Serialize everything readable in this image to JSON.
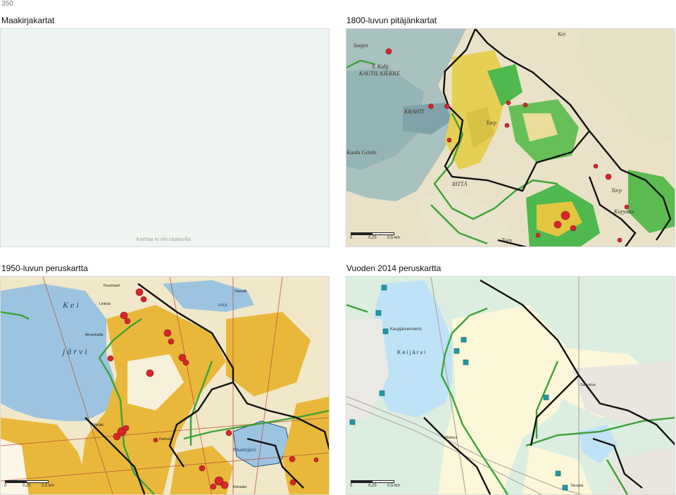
{
  "page_number": "350",
  "panels": {
    "top_left": {
      "title": "Maakirjakartat",
      "note": "Karttaa ei ole saatavilla"
    },
    "top_right": {
      "title": "1800-luvun pitäjänkartat",
      "scale": [
        "0",
        "0,25",
        "0,5 km"
      ]
    },
    "bottom_left": {
      "title": "1950-luvun peruskartta",
      "scale": [
        "0",
        "0,25",
        "0,5 km"
      ]
    },
    "bottom_right": {
      "title": "Vuoden 2014 peruskartta",
      "scale": [
        "0",
        "0,25",
        "0,5 km"
      ]
    }
  },
  "colors": {
    "boundary_black": "#111111",
    "boundary_green": "#3aa335",
    "site_red": "#d9252a",
    "site_teal": "#1e9aa5",
    "water_old": "#8fb0b3",
    "field_yellow": "#e9c53b",
    "meadow_green": "#44b64c"
  }
}
